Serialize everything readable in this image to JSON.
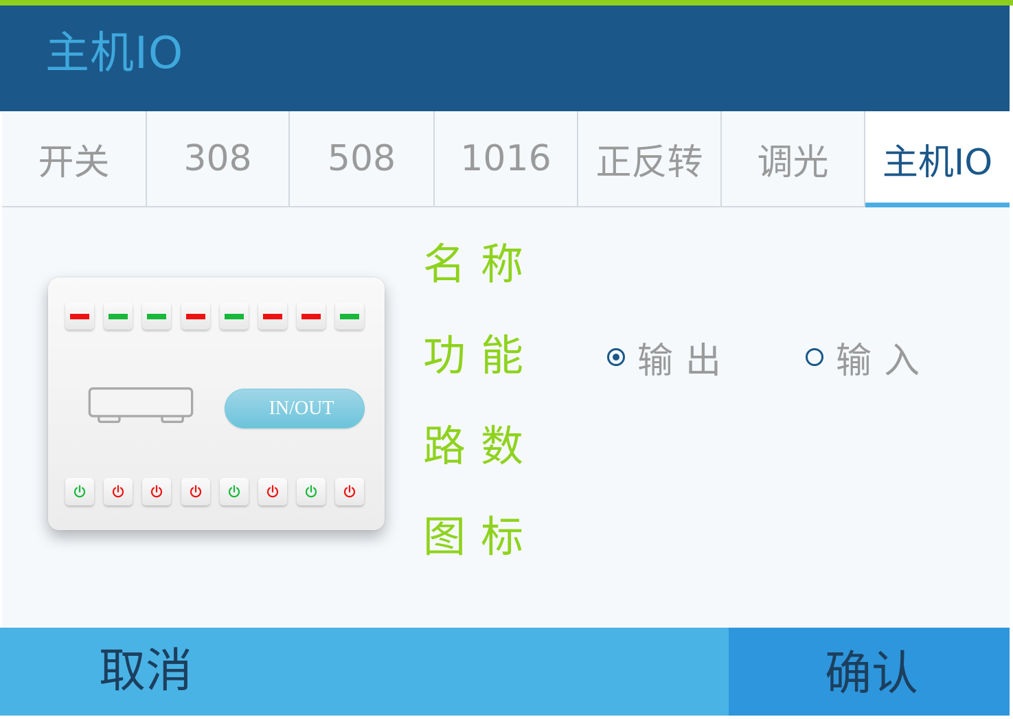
{
  "header": {
    "title": "主机IO"
  },
  "tabs": [
    {
      "label": "开关",
      "active": false
    },
    {
      "label": "308",
      "active": false
    },
    {
      "label": "508",
      "active": false
    },
    {
      "label": "1016",
      "active": false
    },
    {
      "label": "正反转",
      "active": false
    },
    {
      "label": "调光",
      "active": false
    },
    {
      "label": "主机IO",
      "active": true
    }
  ],
  "device": {
    "top_leds": [
      "red",
      "green",
      "green",
      "red",
      "green",
      "red",
      "red",
      "green"
    ],
    "bottom_power": [
      "green",
      "red",
      "red",
      "red",
      "green",
      "red",
      "green",
      "red"
    ],
    "inout_label": "IN/OUT",
    "colors": {
      "red": "#ee1111",
      "green": "#18b83a"
    }
  },
  "form": {
    "name_label": "名称",
    "function_label": "功能",
    "channels_label": "路数",
    "icon_label": "图标",
    "function_options": [
      {
        "label": "输出",
        "selected": true
      },
      {
        "label": "输入",
        "selected": false
      }
    ]
  },
  "footer": {
    "cancel": "取消",
    "confirm": "确认"
  },
  "theme": {
    "header": "#1b5789",
    "accent": "#4aaee3",
    "label": "#8fd21e",
    "top_line": "#8ccf1f"
  }
}
